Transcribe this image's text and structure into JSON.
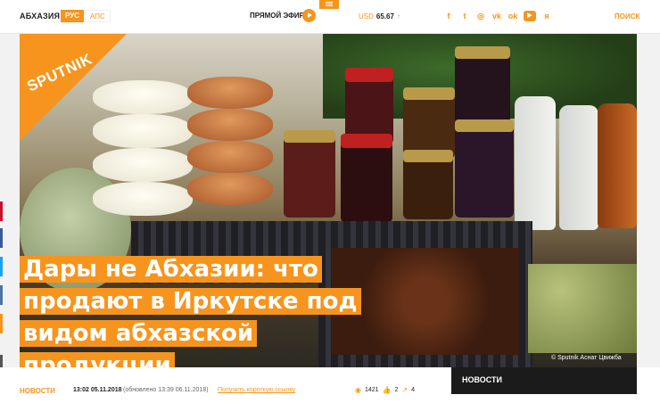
{
  "header": {
    "region": "АБХАЗИЯ",
    "lang_ru": "РУС",
    "lang_aps": "АПС",
    "live": "ПРЯМОЙ ЭФИР",
    "currency_label": "USD",
    "currency_value": "65.67",
    "currency_arrow": "↑",
    "search": "ПОИСК"
  },
  "socials": [
    {
      "icon": "facebook-icon",
      "glyph": "f"
    },
    {
      "icon": "twitter-icon",
      "glyph": "t"
    },
    {
      "icon": "instagram-icon",
      "glyph": "◎"
    },
    {
      "icon": "vk-icon",
      "glyph": "vk"
    },
    {
      "icon": "ok-icon",
      "glyph": "ok"
    },
    {
      "icon": "youtube-icon",
      "glyph": "▶"
    },
    {
      "icon": "yandex-icon",
      "glyph": "я"
    }
  ],
  "hero": {
    "logo": "SPUTNIK",
    "credit": "© Sputnik Аснат Цвижба",
    "headline_lines": [
      "Дары не Абхазии: что",
      "продают в Иркутске под",
      "видом абхазской",
      "продукции"
    ]
  },
  "meta": {
    "category": "НОВОСТИ",
    "date": "13:02 05.11.2018",
    "updated": "(обновлено 13:39 06.11.2018)",
    "shortlink": "Получить короткую ссылку",
    "views": "1421",
    "likes": "2",
    "shares": "4"
  },
  "sidebar": {
    "news_title": "НОВОСТИ"
  },
  "colors": {
    "accent": "#f7941d",
    "dark": "#1b1b1b",
    "share_bar": [
      "#c8102e",
      "#3b5998",
      "#1da1f2",
      "#4c75a3",
      "#f7931e",
      "#555555"
    ]
  }
}
